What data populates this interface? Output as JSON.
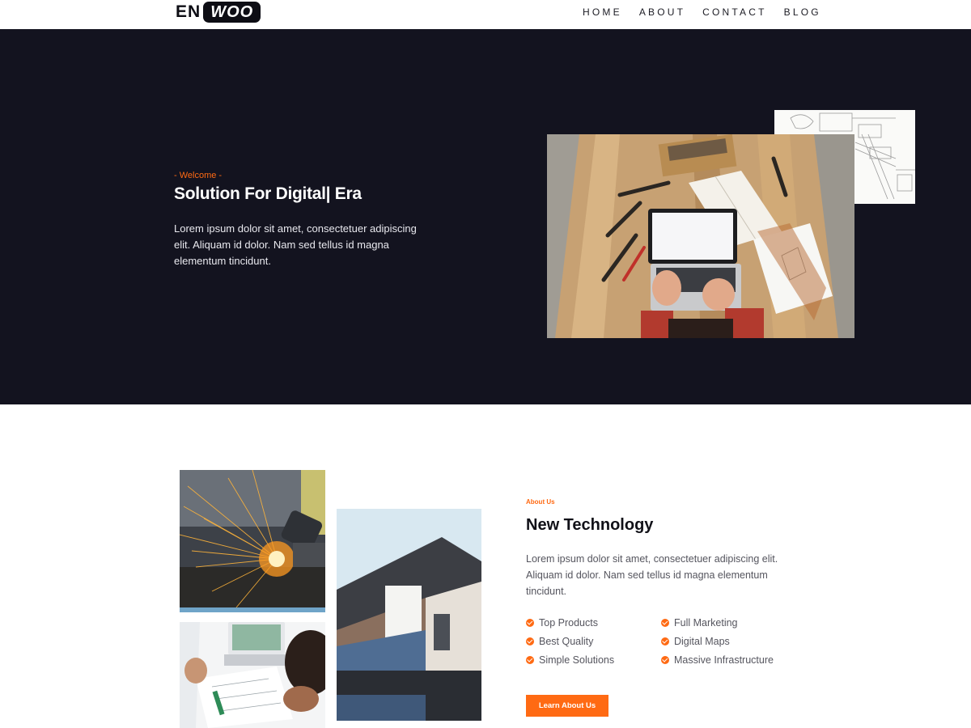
{
  "brand": {
    "part1": "EN",
    "part2": "WOO"
  },
  "nav": {
    "items": [
      "HOME",
      "ABOUT",
      "CONTACT",
      "BLOG"
    ]
  },
  "hero": {
    "kicker": "- Welcome -",
    "title": "Solution For Digital| Era",
    "text": "Lorem ipsum dolor sit amet, consectetuer adipiscing elit. Aliquam id dolor. Nam sed tellus id magna elementum tincidunt."
  },
  "about": {
    "kicker": "About Us",
    "title": "New Technology",
    "text": "Lorem ipsum dolor sit amet, consectetuer adipiscing elit. Aliquam id dolor. Nam sed tellus id magna elementum tincidunt.",
    "features": [
      "Top Products",
      "Full Marketing",
      "Best Quality",
      "Digital Maps",
      "Simple Solutions",
      "Massive Infrastructure"
    ],
    "button_label": "Learn About Us"
  },
  "colors": {
    "accent": "#ff6a13",
    "hero_bg": "#13131f",
    "text_dark": "#111118"
  }
}
